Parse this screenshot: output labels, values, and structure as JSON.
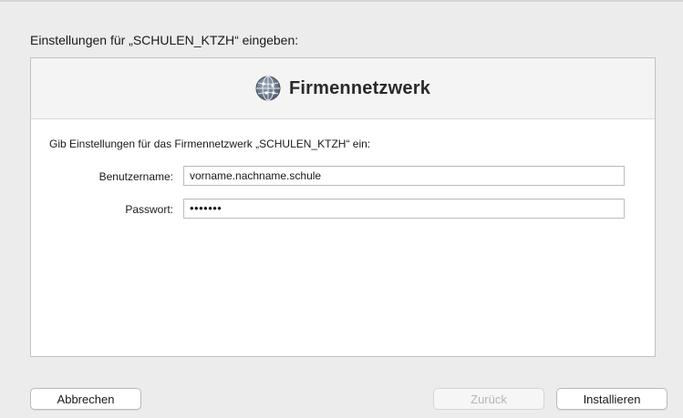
{
  "dialog": {
    "heading": "Einstellungen für „SCHULEN_KTZH“ eingeben:"
  },
  "panel": {
    "title": "Firmennetzwerk",
    "icon": "network-globe-icon",
    "instruction": "Gib Einstellungen für das Firmennetzwerk „SCHULEN_KTZH“ ein:"
  },
  "form": {
    "username_label": "Benutzername:",
    "username_value": "vorname.nachname.schule",
    "password_label": "Passwort:",
    "password_value": "•••••••"
  },
  "buttons": {
    "cancel": "Abbrechen",
    "back": "Zurück",
    "install": "Installieren"
  }
}
